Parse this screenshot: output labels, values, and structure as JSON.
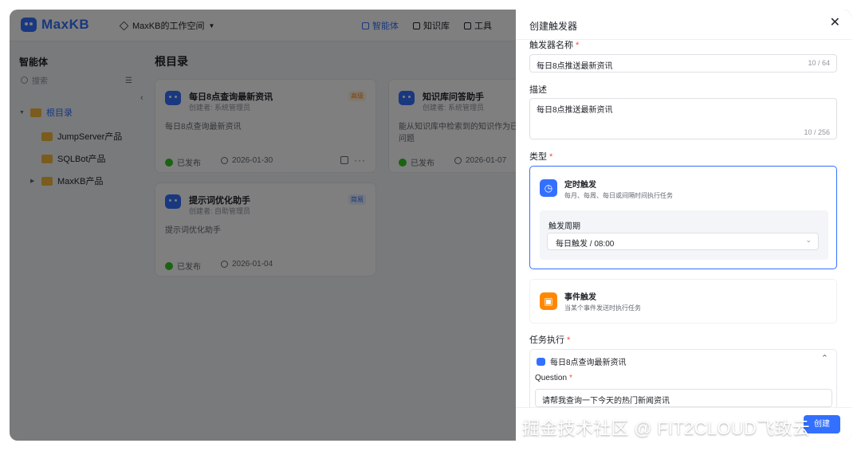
{
  "app": {
    "brand": "MaxKB",
    "workspace": "MaxKB的工作空间"
  },
  "nav": {
    "items": [
      "智能体",
      "知识库",
      "工具"
    ]
  },
  "sidebar": {
    "title": "智能体",
    "search_placeholder": "搜索",
    "tree": [
      "根目录",
      "JumpServer产品",
      "SQLBot产品",
      "MaxKB产品"
    ]
  },
  "main": {
    "title": "根目录",
    "cards": [
      {
        "title": "每日8点查询最新资讯",
        "creator": "创建者: 系统管理员",
        "tag": "高级",
        "desc": "每日8点查询最新资讯",
        "status": "已发布",
        "date": "2026-01-30"
      },
      {
        "title": "知识库问答助手",
        "creator": "创建者: 系统管理员",
        "desc": "能从知识库中检索到的知识作为已知",
        "desc2": "问题",
        "status": "已发布",
        "date": "2026-01-07"
      },
      {
        "title": "提示词优化助手",
        "creator": "创建者: 自助管理员",
        "tag": "简易",
        "desc": "提示词优化助手",
        "status": "已发布",
        "date": "2026-01-04"
      }
    ]
  },
  "drawer": {
    "title": "创建触发器",
    "name_label": "触发器名称",
    "name_value": "每日8点推送最新资讯",
    "name_count": "10 / 64",
    "desc_label": "描述",
    "desc_value": "每日8点推送最新资讯",
    "desc_count": "10 / 256",
    "type_label": "类型",
    "timed": {
      "name": "定时触发",
      "desc": "每月、每周、每日或间隔时间执行任务",
      "period_label": "触发周期",
      "period_value": "每日触发 / 08:00"
    },
    "event": {
      "name": "事件触发",
      "desc": "当某个事件发送时执行任务"
    },
    "task_label": "任务执行",
    "task_name": "每日8点查询最新资讯",
    "question_label": "Question",
    "question_value": "请帮我查询一下今天的热门新闻资讯",
    "footer_btn": "创建"
  },
  "watermark": "掘金技术社区 @ FIT2CLOUD飞致云",
  "colors": {
    "accent": "#3370ff",
    "required": "#f54a45",
    "event_orange": "#ff8800",
    "published_green": "#34c724"
  }
}
